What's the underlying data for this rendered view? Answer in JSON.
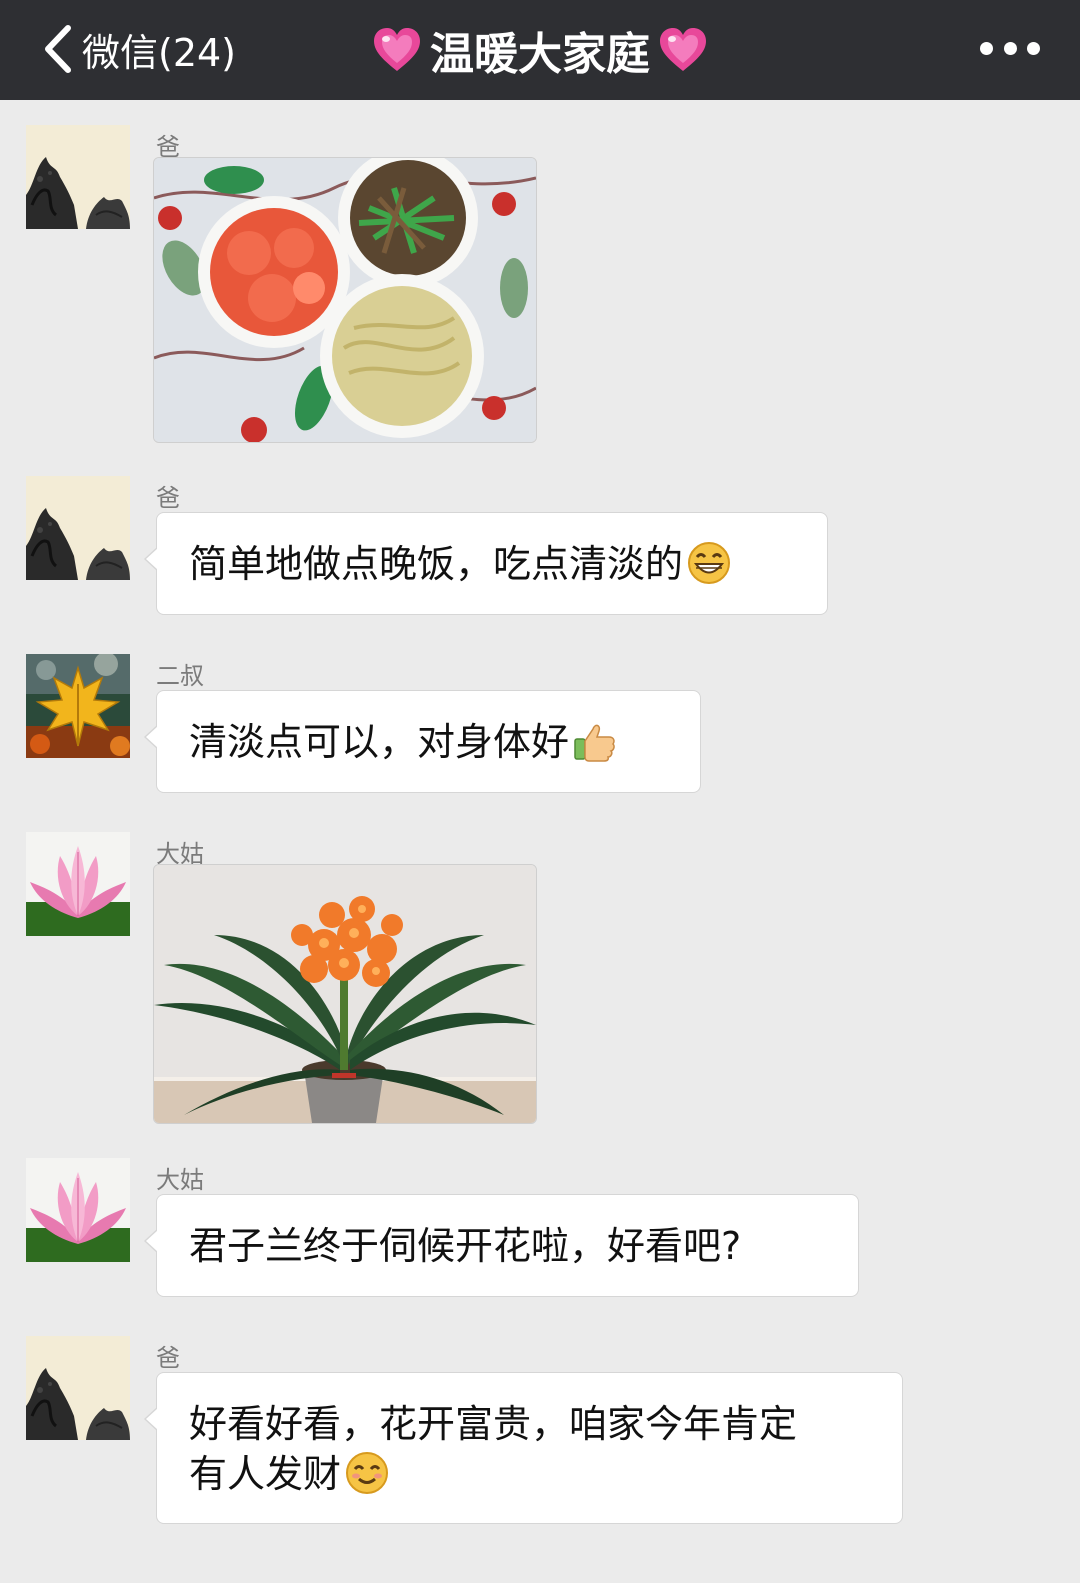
{
  "header": {
    "back_label": "微信(24)",
    "title": "温暖大家庭"
  },
  "messages": [
    {
      "sender": "爸",
      "type": "image",
      "image": "dinner-dishes-photo"
    },
    {
      "sender": "爸",
      "type": "text",
      "text": "简单地做点晚饭，吃点清淡的",
      "emoji": "grin-emoji"
    },
    {
      "sender": "二叔",
      "type": "text",
      "text": "清淡点可以，对身体好",
      "emoji": "thumbs-up-emoji"
    },
    {
      "sender": "大姑",
      "type": "image",
      "image": "clivia-flower-photo"
    },
    {
      "sender": "大姑",
      "type": "text",
      "text": "君子兰终于伺候开花啦，好看吧?"
    },
    {
      "sender": "爸",
      "type": "text",
      "text_line1": "好看好看，花开富贵，咱家今年肯定",
      "text_line2": "有人发财",
      "emoji": "smile-emoji"
    }
  ],
  "colors": {
    "header_bg": "#2e2f33",
    "chat_bg": "#ebebeb",
    "bubble_bg": "#ffffff",
    "heart": "#e8489a"
  }
}
